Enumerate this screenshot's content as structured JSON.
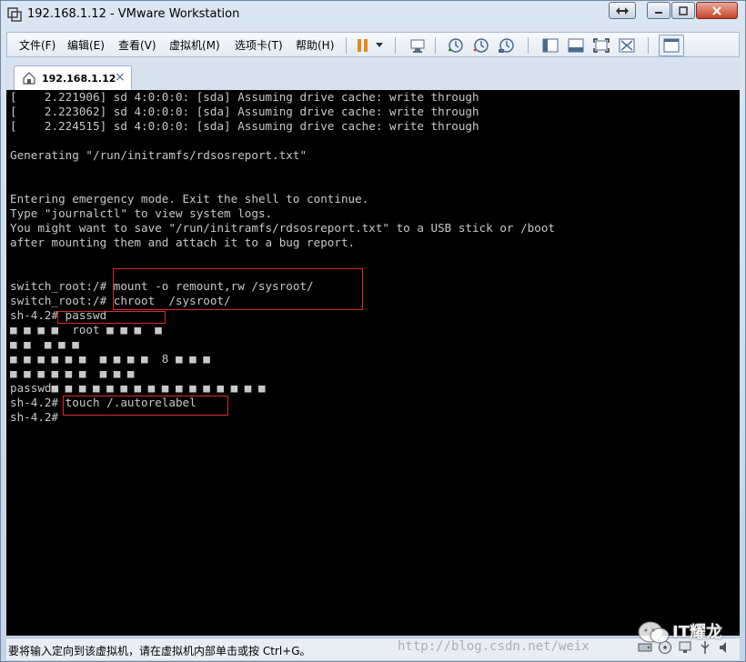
{
  "window": {
    "title": "192.168.1.12 - VMware Workstation"
  },
  "menu": {
    "items": [
      "文件(F)",
      "编辑(E)",
      "查看(V)",
      "虚拟机(M)",
      "选项卡(T)",
      "帮助(H)"
    ]
  },
  "toolbar": {
    "icons": [
      "pause-icon",
      "dropdown-arrow-icon",
      "send-ctrl-alt-del-icon",
      "snapshot-take-icon",
      "snapshot-revert-icon",
      "snapshot-manager-icon",
      "show-library-icon",
      "thumbnail-bar-icon",
      "full-screen-icon",
      "unity-icon",
      "console-view-icon"
    ]
  },
  "tab": {
    "label": "192.168.1.12",
    "close": "×"
  },
  "console": {
    "lines": [
      "[    2.221906] sd 4:0:0:0: [sda] Assuming drive cache: write through",
      "[    2.223062] sd 4:0:0:0: [sda] Assuming drive cache: write through",
      "[    2.224515] sd 4:0:0:0: [sda] Assuming drive cache: write through",
      "",
      "Generating \"/run/initramfs/rdsosreport.txt\"",
      "",
      "",
      "Entering emergency mode. Exit the shell to continue.",
      "Type \"journalctl\" to view system logs.",
      "You might want to save \"/run/initramfs/rdsosreport.txt\" to a USB stick or /boot",
      "after mounting them and attach it to a bug report.",
      "",
      "",
      "switch_root:/# mount -o remount,rw /sysroot/",
      "switch_root:/# chroot  /sysroot/",
      "sh-4.2# passwd",
      "■ ■ ■ ■  root ■ ■ ■  ■",
      "■ ■  ■ ■ ■",
      "■ ■ ■ ■ ■ ■  ■ ■ ■ ■  8 ■ ■ ■",
      "■ ■ ■ ■ ■ ■  ■ ■ ■",
      "passwd■ ■ ■ ■ ■ ■ ■ ■ ■ ■ ■ ■ ■ ■ ■ ■",
      "sh-4.2# touch /.autorelabel",
      "sh-4.2#"
    ]
  },
  "status": {
    "text": "要将输入定向到该虚拟机，请在虚拟机内部单击或按 Ctrl+G。"
  },
  "watermark": {
    "url": "http://blog.csdn.net/weix",
    "brand": "IT耀龙"
  },
  "colors": {
    "terminal_bg": "#000000",
    "terminal_fg": "#c8c8c8",
    "highlight_box": "#d92b2b"
  }
}
